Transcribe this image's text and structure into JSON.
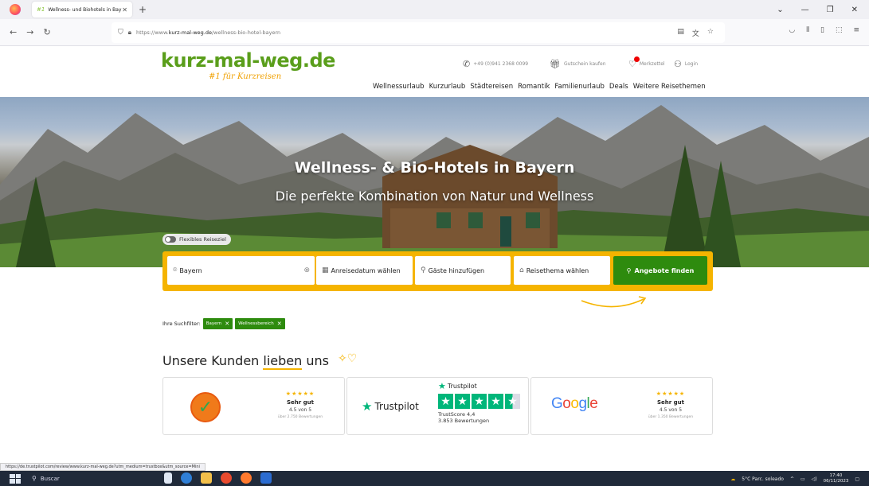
{
  "browser": {
    "tab_title": "Wellness- und Biohotels in Bay",
    "tab_favicon": "#1",
    "url_prefix": "https://www.",
    "url_host": "kurz-mal-weg.de",
    "url_path": "/wellness-bio-hotel-bayern"
  },
  "site": {
    "logo": "kurz-mal-weg.de",
    "tagline": "#1 für Kurzreisen",
    "phone": "+49 (0)941 2368 0099",
    "voucher": "Gutschein kaufen",
    "wishlist": "Merkzettel",
    "login": "Login",
    "nav": [
      "Wellnessurlaub",
      "Kurzurlaub",
      "Städtereisen",
      "Romantik",
      "Familienurlaub",
      "Deals",
      "Weitere Reisethemen"
    ]
  },
  "hero": {
    "title": "Wellness- & Bio-Hotels in Bayern",
    "subtitle": "Die perfekte Kombination von Natur und Wellness",
    "flex_label": "Flexibles Reiseziel"
  },
  "search": {
    "destination": "Bayern",
    "date": "Anreisedatum wählen",
    "guests": "Gäste hinzufügen",
    "theme": "Reisethema wählen",
    "button": "Angebote finden"
  },
  "filters": {
    "label": "Ihre Suchfilter:",
    "chips": [
      "Bayern",
      "Wellnessbereich"
    ]
  },
  "reviews": {
    "title_pre": "Unsere Kunden ",
    "title_hl": "lieben",
    "title_post": " uns",
    "cards": [
      {
        "verdict": "Sehr gut",
        "score": "4.5 von 5",
        "count": "über 2.750 Bewertungen",
        "rating": 4.5
      },
      {
        "brand": "Trustpilot",
        "trustscore": "TrustScore 4,4",
        "count": "3.853 Bewertungen",
        "rating": 4.5
      },
      {
        "brand": "Google",
        "verdict": "Sehr gut",
        "score": "4.5 von 5",
        "count": "über 1.350 Bewertungen",
        "rating": 4.5
      }
    ]
  },
  "status_link": "https://de.trustpilot.com/review/www.kurz-mal-weg.de?utm_medium=trustbox&utm_source=Mini",
  "taskbar": {
    "search": "Buscar",
    "weather": "5°C Parc. soleado",
    "time": "17:40",
    "date": "06/11/2023"
  }
}
